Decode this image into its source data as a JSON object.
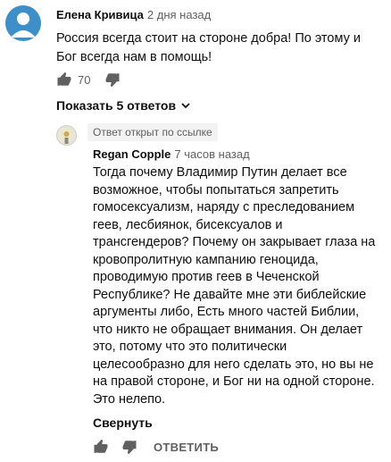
{
  "comment": {
    "author": "Елена Кривица",
    "time": "2 дня назад",
    "text": "Россия  всегда стоит на стороне добра! По этому и Бог всегда нам в помощь!",
    "likes": "70",
    "show_replies_label": "Показать 5 ответов"
  },
  "reply": {
    "linked_badge": "Ответ открыт по ссылке",
    "author": "Regan Copple",
    "time": "7 часов назад",
    "text": "Тогда почему Владимир Путин делает все\nвозможное, чтобы попытаться запретить\nгомосексуализм, наряду с преследованием\nгеев, лесбиянок, бисексуалов и\nтрансгендеров? Почему он закрывает глаза на\nкровопролитную кампанию геноцида,\nпроводимую против геев в Чеченской\nРеспублике? Не давайте мне эти библейские\nаргументы либо, Есть много частей Библии,\nчто никто не обращает внимания. Он делает\nэто, потому что это политически\nцелесообразно для него сделать это, но вы не\nна правой стороне, и Бог ни на одной стороне.\nЭто нелепо.",
    "collapse_label": "Свернуть",
    "reply_label": "ОТВЕТИТЬ"
  },
  "icons": {
    "like": "thumb-up-icon",
    "dislike": "thumb-down-icon",
    "expand": "chevron-down-icon"
  },
  "colors": {
    "avatar1": "#3c8fc9",
    "secondary_text": "#606060"
  }
}
